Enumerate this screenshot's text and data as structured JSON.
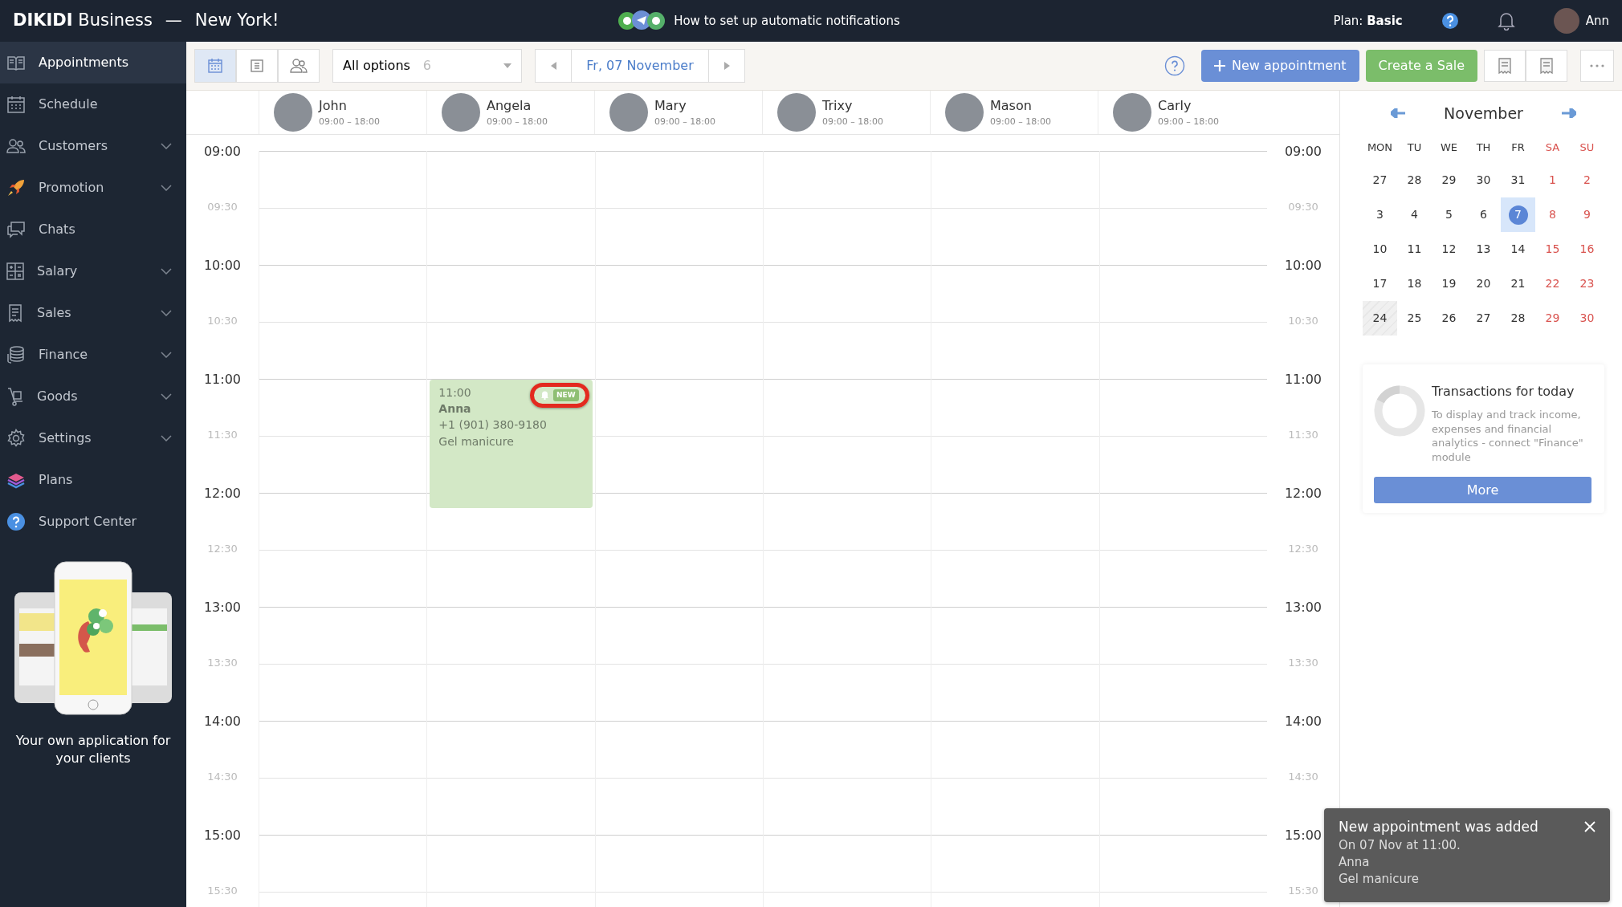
{
  "topbar": {
    "brand": "DIKIDI Business",
    "separator": "—",
    "location": "New York!",
    "tip": "How to set up automatic notifications",
    "plan_label": "Plan:",
    "plan": "Basic",
    "user": "Ann"
  },
  "sidebar": {
    "items": [
      {
        "label": "Appointments",
        "expandable": false,
        "selected": true
      },
      {
        "label": "Schedule",
        "expandable": false,
        "selected": false
      },
      {
        "label": "Customers",
        "expandable": true,
        "selected": false
      },
      {
        "label": "Promotion",
        "expandable": true,
        "selected": false
      },
      {
        "label": "Chats",
        "expandable": false,
        "selected": false
      },
      {
        "label": "Salary",
        "expandable": true,
        "selected": false
      },
      {
        "label": "Sales",
        "expandable": true,
        "selected": false
      },
      {
        "label": "Finance",
        "expandable": true,
        "selected": false
      },
      {
        "label": "Goods",
        "expandable": true,
        "selected": false
      },
      {
        "label": "Settings",
        "expandable": true,
        "selected": false
      },
      {
        "label": "Plans",
        "expandable": false,
        "selected": false
      },
      {
        "label": "Support Center",
        "expandable": false,
        "selected": false
      }
    ],
    "promo": "Your own application for your clients"
  },
  "toolbar": {
    "views": [
      {
        "kind": "calendar",
        "selected": true
      },
      {
        "kind": "list",
        "selected": false
      },
      {
        "kind": "staff",
        "selected": false
      }
    ],
    "filter": {
      "value": "All options",
      "count": "6"
    },
    "date": "Fr, 07 November",
    "new_button": "New appointment",
    "sale_button": "Create a Sale"
  },
  "staff": [
    {
      "name": "John",
      "hours": "09:00 – 18:00"
    },
    {
      "name": "Angela",
      "hours": "09:00 – 18:00",
      "appointments": [
        {
          "time": "11:00",
          "client": "Anna",
          "phone": "+1 (901) 380-9180",
          "service": "Gel manicure",
          "badge": "NEW",
          "highlighted": true
        }
      ]
    },
    {
      "name": "Mary",
      "hours": "09:00 – 18:00"
    },
    {
      "name": "Trixy",
      "hours": "09:00 – 18:00"
    },
    {
      "name": "Mason",
      "hours": "09:00 – 18:00"
    },
    {
      "name": "Carly",
      "hours": "09:00 – 18:00"
    }
  ],
  "time_rows": [
    {
      "left": "09:00",
      "right": "09:00",
      "hour": true
    },
    {
      "left": "09:30",
      "right": "09:30",
      "hour": false
    },
    {
      "left": "10:00",
      "right": "10:00",
      "hour": true
    },
    {
      "left": "10:30",
      "right": "10:30",
      "hour": false
    },
    {
      "left": "11:00",
      "right": "11:00",
      "hour": true
    },
    {
      "left": "11:30",
      "right": "11:30",
      "hour": false
    },
    {
      "left": "12:00",
      "right": "12:00",
      "hour": true
    },
    {
      "left": "12:30",
      "right": "12:30",
      "hour": false
    },
    {
      "left": "13:00",
      "right": "13:00",
      "hour": true
    },
    {
      "left": "13:30",
      "right": "13:30",
      "hour": false
    },
    {
      "left": "14:00",
      "right": "14:00",
      "hour": true
    },
    {
      "left": "14:30",
      "right": "14:30",
      "hour": false
    },
    {
      "left": "15:00",
      "right": "15:00",
      "hour": true
    },
    {
      "left": "15:30",
      "right": "15:30",
      "hour": false
    }
  ],
  "calendar": {
    "month": "November",
    "weekdays": [
      {
        "label": "MON",
        "weekend": false
      },
      {
        "label": "TU",
        "weekend": false
      },
      {
        "label": "WE",
        "weekend": false
      },
      {
        "label": "TH",
        "weekend": false
      },
      {
        "label": "FR",
        "weekend": false
      },
      {
        "label": "SA",
        "weekend": true
      },
      {
        "label": "SU",
        "weekend": true
      }
    ],
    "weeks": [
      {
        "days": [
          {
            "day": "27",
            "weekend": false,
            "selected": false,
            "off": false
          },
          {
            "day": "28",
            "weekend": false,
            "selected": false,
            "off": false
          },
          {
            "day": "29",
            "weekend": false,
            "selected": false,
            "off": false
          },
          {
            "day": "30",
            "weekend": false,
            "selected": false,
            "off": false
          },
          {
            "day": "31",
            "weekend": false,
            "selected": false,
            "off": false
          },
          {
            "day": "1",
            "weekend": true,
            "selected": false,
            "off": false
          },
          {
            "day": "2",
            "weekend": true,
            "selected": false,
            "off": false
          }
        ]
      },
      {
        "days": [
          {
            "day": "3",
            "weekend": false,
            "selected": false,
            "off": false
          },
          {
            "day": "4",
            "weekend": false,
            "selected": false,
            "off": false
          },
          {
            "day": "5",
            "weekend": false,
            "selected": false,
            "off": false
          },
          {
            "day": "6",
            "weekend": false,
            "selected": false,
            "off": false
          },
          {
            "day": "7",
            "weekend": false,
            "selected": true,
            "off": false
          },
          {
            "day": "8",
            "weekend": true,
            "selected": false,
            "off": false
          },
          {
            "day": "9",
            "weekend": true,
            "selected": false,
            "off": false
          }
        ]
      },
      {
        "days": [
          {
            "day": "10",
            "weekend": false,
            "selected": false,
            "off": false
          },
          {
            "day": "11",
            "weekend": false,
            "selected": false,
            "off": false
          },
          {
            "day": "12",
            "weekend": false,
            "selected": false,
            "off": false
          },
          {
            "day": "13",
            "weekend": false,
            "selected": false,
            "off": false
          },
          {
            "day": "14",
            "weekend": false,
            "selected": false,
            "off": false
          },
          {
            "day": "15",
            "weekend": true,
            "selected": false,
            "off": false
          },
          {
            "day": "16",
            "weekend": true,
            "selected": false,
            "off": false
          }
        ]
      },
      {
        "days": [
          {
            "day": "17",
            "weekend": false,
            "selected": false,
            "off": false
          },
          {
            "day": "18",
            "weekend": false,
            "selected": false,
            "off": false
          },
          {
            "day": "19",
            "weekend": false,
            "selected": false,
            "off": false
          },
          {
            "day": "20",
            "weekend": false,
            "selected": false,
            "off": false
          },
          {
            "day": "21",
            "weekend": false,
            "selected": false,
            "off": false
          },
          {
            "day": "22",
            "weekend": true,
            "selected": false,
            "off": false
          },
          {
            "day": "23",
            "weekend": true,
            "selected": false,
            "off": false
          }
        ]
      },
      {
        "days": [
          {
            "day": "24",
            "weekend": false,
            "selected": false,
            "off": true
          },
          {
            "day": "25",
            "weekend": false,
            "selected": false,
            "off": false
          },
          {
            "day": "26",
            "weekend": false,
            "selected": false,
            "off": false
          },
          {
            "day": "27",
            "weekend": false,
            "selected": false,
            "off": false
          },
          {
            "day": "28",
            "weekend": false,
            "selected": false,
            "off": false
          },
          {
            "day": "29",
            "weekend": true,
            "selected": false,
            "off": false
          },
          {
            "day": "30",
            "weekend": true,
            "selected": false,
            "off": false
          }
        ]
      }
    ]
  },
  "transactions": {
    "title": "Transactions for today",
    "text": "To display and track income, expenses and financial analytics - connect \"Finance\" module",
    "button": "More"
  },
  "toast": {
    "title": "New appointment was added",
    "lines": [
      "On 07 Nov at 11:00.",
      "Anna",
      "Gel manicure"
    ]
  }
}
